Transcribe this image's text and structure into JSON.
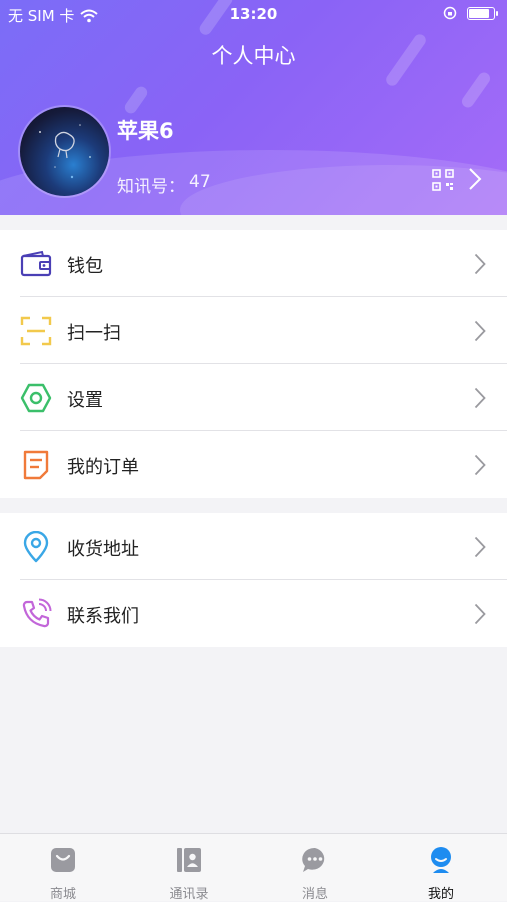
{
  "status_bar": {
    "carrier": "无 SIM 卡",
    "time": "13:20",
    "battery_level": 0.9
  },
  "header": {
    "title": "个人中心",
    "username": "苹果6",
    "id_label": "知讯号：",
    "id_value": "47"
  },
  "menu_groups": [
    {
      "items": [
        {
          "label": "钱包",
          "icon": "wallet-icon",
          "color": "#4a3fb5"
        },
        {
          "label": "扫一扫",
          "icon": "scan-icon",
          "color": "#f2c94c"
        },
        {
          "label": "设置",
          "icon": "settings-icon",
          "color": "#3bbf6a"
        },
        {
          "label": "我的订单",
          "icon": "order-icon",
          "color": "#f07a3a"
        }
      ]
    },
    {
      "items": [
        {
          "label": "收货地址",
          "icon": "location-icon",
          "color": "#3aa7e6"
        },
        {
          "label": "联系我们",
          "icon": "phone-icon",
          "color": "#c266d9"
        }
      ]
    }
  ],
  "tabbar": {
    "items": [
      {
        "label": "商城",
        "icon": "shop-icon"
      },
      {
        "label": "通讯录",
        "icon": "contacts-icon"
      },
      {
        "label": "消息",
        "icon": "message-icon"
      },
      {
        "label": "我的",
        "icon": "profile-icon",
        "active": true
      }
    ]
  },
  "colors": {
    "header_start": "#7b6df7",
    "header_end": "#a56cf8",
    "active_tab": "#1e8cf0",
    "inactive_tab": "#9a9aa0"
  }
}
